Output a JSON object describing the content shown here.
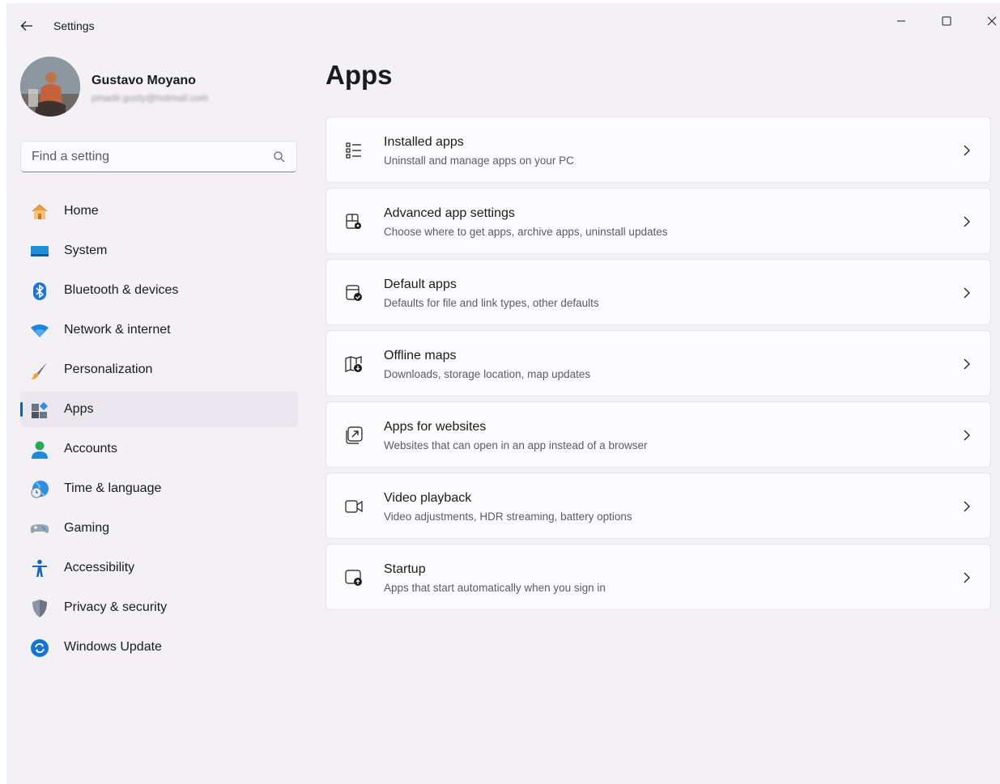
{
  "window": {
    "title": "Settings"
  },
  "profile": {
    "name": "Gustavo Moyano",
    "email": "pinadir.gusty@hotmail.com"
  },
  "search": {
    "placeholder": "Find a setting"
  },
  "nav": {
    "items": [
      {
        "label": "Home",
        "icon": "home-icon"
      },
      {
        "label": "System",
        "icon": "system-icon"
      },
      {
        "label": "Bluetooth & devices",
        "icon": "bluetooth-icon"
      },
      {
        "label": "Network & internet",
        "icon": "wifi-icon"
      },
      {
        "label": "Personalization",
        "icon": "brush-icon"
      },
      {
        "label": "Apps",
        "icon": "apps-icon",
        "selected": true
      },
      {
        "label": "Accounts",
        "icon": "person-icon"
      },
      {
        "label": "Time & language",
        "icon": "globe-clock-icon"
      },
      {
        "label": "Gaming",
        "icon": "gamepad-icon"
      },
      {
        "label": "Accessibility",
        "icon": "accessibility-icon"
      },
      {
        "label": "Privacy & security",
        "icon": "shield-icon"
      },
      {
        "label": "Windows Update",
        "icon": "update-icon"
      }
    ]
  },
  "main": {
    "title": "Apps",
    "cards": [
      {
        "title": "Installed apps",
        "desc": "Uninstall and manage apps on your PC",
        "icon": "list-icon"
      },
      {
        "title": "Advanced app settings",
        "desc": "Choose where to get apps, archive apps, uninstall updates",
        "icon": "app-settings-icon"
      },
      {
        "title": "Default apps",
        "desc": "Defaults for file and link types, other defaults",
        "icon": "default-apps-icon"
      },
      {
        "title": "Offline maps",
        "desc": "Downloads, storage location, map updates",
        "icon": "map-download-icon"
      },
      {
        "title": "Apps for websites",
        "desc": "Websites that can open in an app instead of a browser",
        "icon": "open-in-app-icon"
      },
      {
        "title": "Video playback",
        "desc": "Video adjustments, HDR streaming, battery options",
        "icon": "video-icon"
      },
      {
        "title": "Startup",
        "desc": "Apps that start automatically when you sign in",
        "icon": "startup-icon"
      }
    ]
  },
  "colors": {
    "accent": "#0067c0",
    "background": "#f3f0f6",
    "card": "#fcfbfd"
  }
}
